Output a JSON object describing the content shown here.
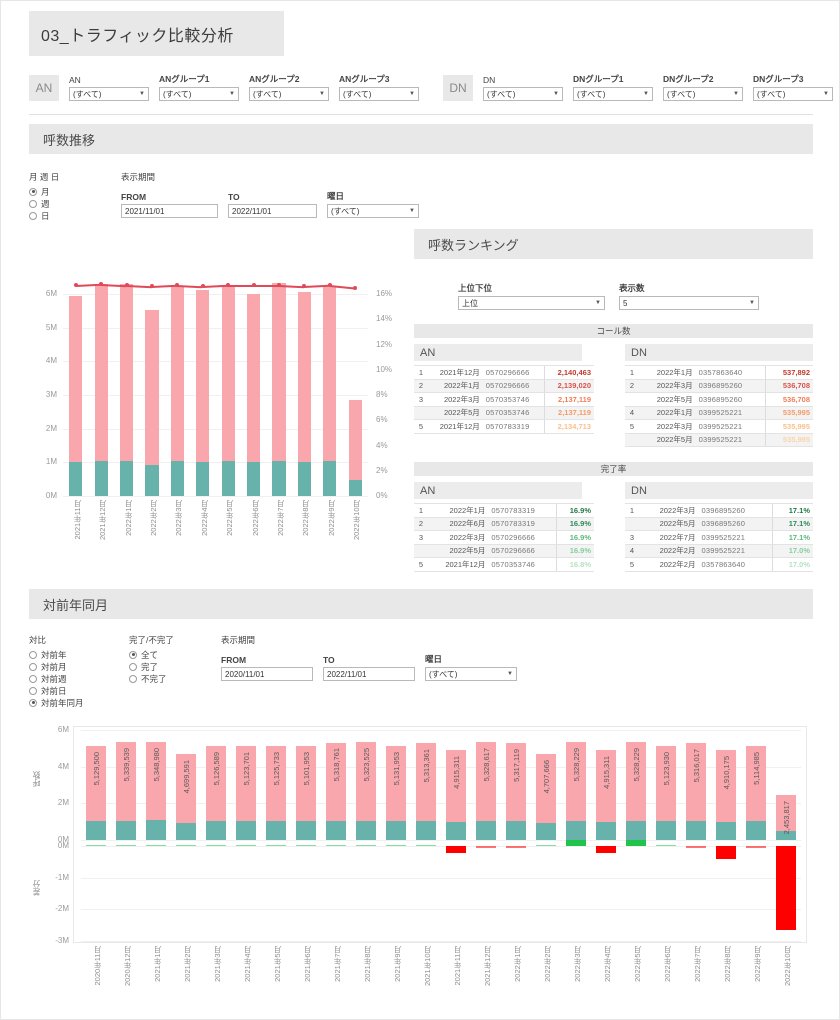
{
  "header": {
    "title": "03_トラフィック比較分析"
  },
  "filters": {
    "an": {
      "badge": "AN",
      "fields": [
        {
          "label": "AN",
          "value": "(すべて)"
        },
        {
          "label": "ANグループ1",
          "value": "(すべて)"
        },
        {
          "label": "ANグループ2",
          "value": "(すべて)"
        },
        {
          "label": "ANグループ3",
          "value": "(すべて)"
        }
      ]
    },
    "dn": {
      "badge": "DN",
      "fields": [
        {
          "label": "DN",
          "value": "(すべて)"
        },
        {
          "label": "DNグループ1",
          "value": "(すべて)"
        },
        {
          "label": "DNグループ2",
          "value": "(すべて)"
        },
        {
          "label": "DNグループ3",
          "value": "(すべて)"
        }
      ]
    }
  },
  "trend_section": {
    "title": "呼数推移",
    "granularity": {
      "caption": "月 週 日",
      "options": [
        "月",
        "週",
        "日"
      ],
      "selected": "月"
    },
    "period": {
      "caption": "表示期間",
      "from_label": "FROM",
      "from_value": "2021/11/01",
      "to_label": "TO",
      "to_value": "2022/11/01",
      "weekday_label": "曜日",
      "weekday_value": "(すべて)"
    }
  },
  "ranking_section": {
    "title": "呼数ランキング",
    "order": {
      "label": "上位下位",
      "value": "上位"
    },
    "count": {
      "label": "表示数",
      "value": "5"
    },
    "calls_title": "コール数",
    "rate_title": "完了率",
    "calls_an": {
      "header": "AN",
      "rows": [
        {
          "rank": "1",
          "month": "2021年12月",
          "number": "0570296666",
          "value": "2,140,463"
        },
        {
          "rank": "2",
          "month": "2022年1月",
          "number": "0570296666",
          "value": "2,139,020"
        },
        {
          "rank": "3",
          "month": "2022年3月",
          "number": "0570353746",
          "value": "2,137,119"
        },
        {
          "rank": "",
          "month": "2022年5月",
          "number": "0570353746",
          "value": "2,137,119"
        },
        {
          "rank": "5",
          "month": "2021年12月",
          "number": "0570783319",
          "value": "2,134,713"
        }
      ]
    },
    "calls_dn": {
      "header": "DN",
      "rows": [
        {
          "rank": "1",
          "month": "2022年1月",
          "number": "0357863640",
          "value": "537,892"
        },
        {
          "rank": "2",
          "month": "2022年3月",
          "number": "0396895260",
          "value": "536,708"
        },
        {
          "rank": "",
          "month": "2022年5月",
          "number": "0396895260",
          "value": "536,708"
        },
        {
          "rank": "4",
          "month": "2022年1月",
          "number": "0399525221",
          "value": "535,995"
        },
        {
          "rank": "5",
          "month": "2022年3月",
          "number": "0399525221",
          "value": "535,995"
        },
        {
          "rank": "",
          "month": "2022年5月",
          "number": "0399525221",
          "value": "535,995"
        }
      ]
    },
    "rate_an": {
      "header": "AN",
      "rows": [
        {
          "rank": "1",
          "month": "2022年1月",
          "number": "0570783319",
          "value": "16.9%"
        },
        {
          "rank": "2",
          "month": "2022年6月",
          "number": "0570783319",
          "value": "16.9%"
        },
        {
          "rank": "3",
          "month": "2022年3月",
          "number": "0570296666",
          "value": "16.9%"
        },
        {
          "rank": "",
          "month": "2022年5月",
          "number": "0570296666",
          "value": "16.9%"
        },
        {
          "rank": "5",
          "month": "2021年12月",
          "number": "0570353746",
          "value": "16.8%"
        }
      ]
    },
    "rate_dn": {
      "header": "DN",
      "rows": [
        {
          "rank": "1",
          "month": "2022年3月",
          "number": "0396895260",
          "value": "17.1%"
        },
        {
          "rank": "",
          "month": "2022年5月",
          "number": "0396895260",
          "value": "17.1%"
        },
        {
          "rank": "3",
          "month": "2022年7月",
          "number": "0399525221",
          "value": "17.1%"
        },
        {
          "rank": "4",
          "month": "2022年2月",
          "number": "0399525221",
          "value": "17.0%"
        },
        {
          "rank": "5",
          "month": "2022年2月",
          "number": "0357863640",
          "value": "17.0%"
        }
      ]
    }
  },
  "yoy_section": {
    "title": "対前年同月",
    "compare": {
      "caption": "対比",
      "options": [
        "対前年",
        "対前月",
        "対前週",
        "対前日",
        "対前年同月"
      ],
      "selected": "対前年同月"
    },
    "completion": {
      "caption": "完了/不完了",
      "options": [
        "全て",
        "完了",
        "不完了"
      ],
      "selected": "全て"
    },
    "period": {
      "caption": "表示期間",
      "from_label": "FROM",
      "from_value": "2020/11/01",
      "to_label": "TO",
      "to_value": "2022/11/01",
      "weekday_label": "曜日",
      "weekday_value": "(すべて)"
    }
  },
  "chart_data": [
    {
      "type": "bar",
      "name": "trend-chart",
      "title": "呼数推移",
      "categories": [
        "2021年11月",
        "2021年12月",
        "2022年1月",
        "2022年2月",
        "2022年3月",
        "2022年4月",
        "2022年5月",
        "2022年6月",
        "2022年7月",
        "2022年8月",
        "2022年9月",
        "2022年10月"
      ],
      "series": [
        {
          "name": "完了",
          "type": "bar-segment",
          "color": "#67b3ab",
          "values": [
            1.0,
            1.05,
            1.05,
            0.92,
            1.04,
            1.02,
            1.04,
            1.0,
            1.05,
            1.01,
            1.04,
            0.48
          ]
        },
        {
          "name": "不完了",
          "type": "bar-segment",
          "color": "#f9a7ad",
          "values": [
            4.93,
            5.24,
            5.26,
            4.62,
            5.2,
            5.11,
            5.19,
            5.01,
            5.27,
            5.05,
            5.2,
            2.38
          ]
        },
        {
          "name": "完了率",
          "type": "line",
          "color": "#e04a58",
          "axis": "right",
          "values": [
            16.7,
            16.8,
            16.7,
            16.6,
            16.7,
            16.6,
            16.7,
            16.7,
            16.7,
            16.6,
            16.7,
            16.5
          ]
        }
      ],
      "ylabel": "",
      "ylim": [
        0,
        6
      ],
      "yticks": [
        "0M",
        "1M",
        "2M",
        "3M",
        "4M",
        "5M",
        "6M"
      ],
      "y2lim": [
        0,
        16
      ],
      "y2ticks": [
        "0%",
        "2%",
        "4%",
        "6%",
        "8%",
        "10%",
        "12%",
        "14%",
        "16%"
      ],
      "grid": true,
      "legend": "none"
    },
    {
      "type": "bar",
      "name": "yoy-calls-chart",
      "title": "対前年同月 呼数",
      "ylabel": "呼数",
      "categories": [
        "2020年11月",
        "2020年12月",
        "2021年1月",
        "2021年2月",
        "2021年3月",
        "2021年4月",
        "2021年5月",
        "2021年6月",
        "2021年7月",
        "2021年8月",
        "2021年9月",
        "2021年10月",
        "2021年11月",
        "2021年12月",
        "2022年1月",
        "2022年2月",
        "2022年3月",
        "2022年4月",
        "2022年5月",
        "2022年6月",
        "2022年7月",
        "2022年8月",
        "2022年9月",
        "2022年10月"
      ],
      "labels": [
        "5,129,500",
        "5,339,539",
        "5,348,980",
        "4,699,591",
        "5,126,589",
        "5,123,701",
        "5,125,733",
        "5,101,953",
        "5,318,761",
        "5,323,525",
        "5,131,953",
        "5,313,361",
        "4,915,311",
        "5,328,617",
        "5,317,119",
        "4,707,666",
        "5,328,229",
        "4,915,311",
        "5,328,229",
        "5,123,930",
        "5,316,017",
        "4,910,175",
        "5,114,985",
        "2,453,817"
      ],
      "values": [
        5129500,
        5339539,
        5348980,
        4699591,
        5126589,
        5123701,
        5125733,
        5101953,
        5318761,
        5323525,
        5131953,
        5313361,
        4915311,
        5328617,
        5317119,
        4707666,
        5328229,
        4915311,
        5328229,
        5123930,
        5316017,
        4910175,
        5114985,
        2453817
      ],
      "segment_lower": [
        1020000,
        1060000,
        1070000,
        930000,
        1020000,
        1020000,
        1020000,
        1010000,
        1060000,
        1060000,
        1020000,
        1060000,
        980000,
        1060000,
        1060000,
        940000,
        1060000,
        980000,
        1060000,
        1020000,
        1060000,
        980000,
        1020000,
        490000
      ],
      "ylim": [
        0,
        6000000
      ],
      "yticks": [
        "0M",
        "2M",
        "4M",
        "6M"
      ],
      "grid": true
    },
    {
      "type": "bar",
      "name": "yoy-difference-chart",
      "title": "対前年同月 差分",
      "ylabel": "差分",
      "categories": [
        "2020年11月",
        "2020年12月",
        "2021年1月",
        "2021年2月",
        "2021年3月",
        "2021年4月",
        "2021年5月",
        "2021年6月",
        "2021年7月",
        "2021年8月",
        "2021年9月",
        "2021年10月",
        "2021年11月",
        "2021年12月",
        "2022年1月",
        "2022年2月",
        "2022年3月",
        "2022年4月",
        "2022年5月",
        "2022年6月",
        "2022年7月",
        "2022年8月",
        "2022年9月",
        "2022年10月"
      ],
      "values": [
        0,
        0,
        0,
        0,
        0,
        0,
        0,
        0,
        0,
        0,
        0,
        0,
        -214189,
        -10922,
        -31861,
        8075,
        201640,
        -208414,
        202496,
        22029,
        -2744,
        -413350,
        -16968,
        -2661168
      ],
      "ylim": [
        -3000000,
        0
      ],
      "yticks": [
        "0M",
        "-1M",
        "-2M",
        "-3M"
      ],
      "positive_color": "#22c34b",
      "negative_color": "#ff0000",
      "grid": true
    }
  ]
}
